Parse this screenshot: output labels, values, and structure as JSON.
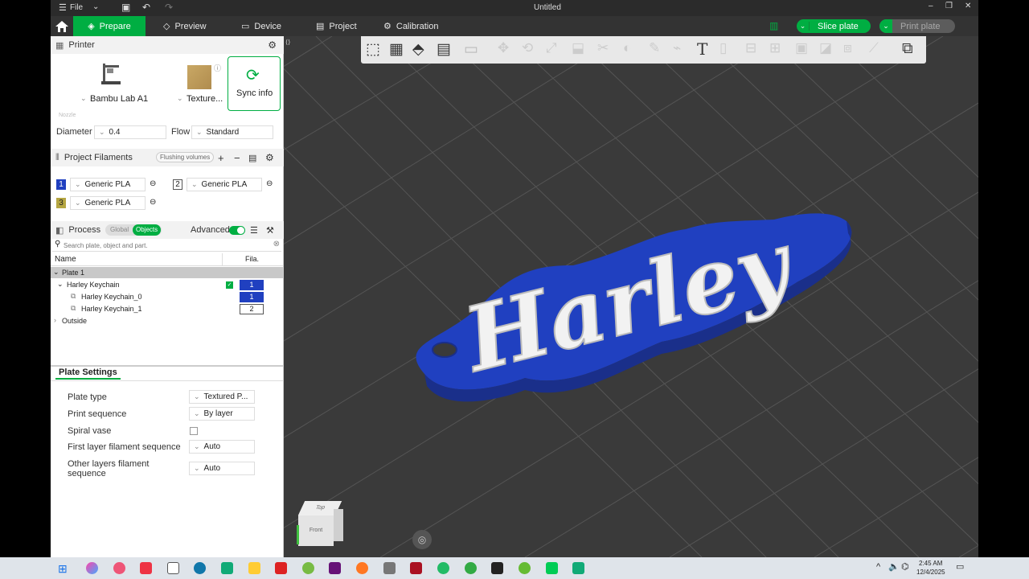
{
  "window": {
    "menu_file": "File",
    "title": "Untitled"
  },
  "tabs": {
    "prepare": "Prepare",
    "preview": "Preview",
    "device": "Device",
    "project": "Project",
    "calibration": "Calibration"
  },
  "actions": {
    "slice": "Slice plate",
    "print": "Print plate"
  },
  "printer": {
    "header": "Printer",
    "name": "Bambu Lab A1",
    "plate": "Texture...",
    "sync": "Sync info",
    "nozzle_label": "Nozzle",
    "diameter_label": "Diameter",
    "diameter_value": "0.4",
    "flow_label": "Flow",
    "flow_value": "Standard"
  },
  "filaments": {
    "header": "Project Filaments",
    "flushing": "Flushing volumes",
    "items": [
      {
        "num": "1",
        "name": "Generic PLA",
        "color": "#2040c0"
      },
      {
        "num": "2",
        "name": "Generic PLA",
        "color": "#ffffff"
      },
      {
        "num": "3",
        "name": "Generic PLA",
        "color": "#b5a642"
      }
    ]
  },
  "process": {
    "header": "Process",
    "global": "Global",
    "objects": "Objects",
    "advanced": "Advanced"
  },
  "objects": {
    "search_placeholder": "Search plate, object and part.",
    "col_name": "Name",
    "col_fila": "Fila.",
    "plate": "Plate 1",
    "object": "Harley Keychain",
    "object_fila": "1",
    "parts": [
      {
        "name": "Harley Keychain_0",
        "fila": "1"
      },
      {
        "name": "Harley Keychain_1",
        "fila": "2"
      }
    ],
    "outside": "Outside"
  },
  "plate_settings": {
    "header": "Plate Settings",
    "rows": [
      {
        "label": "Plate type",
        "value": "Textured P..."
      },
      {
        "label": "Print sequence",
        "value": "By layer"
      },
      {
        "label": "Spiral vase",
        "value": ""
      },
      {
        "label": "First layer filament sequence",
        "value": "Auto"
      },
      {
        "label": "Other layers filament sequence",
        "value": "Auto"
      }
    ]
  },
  "model": {
    "text": "Harley"
  },
  "viewcube": {
    "top": "Top",
    "front": "Front"
  },
  "clock": {
    "time": "2:45 AM",
    "date": "12/4/2025"
  },
  "colors": {
    "accent": "#00ae42",
    "blue": "#2040c0",
    "viewport_bg": "#3a3a3a"
  }
}
